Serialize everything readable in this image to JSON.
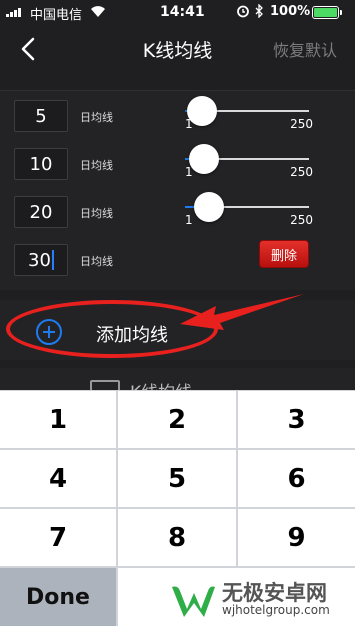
{
  "status_bar": {
    "carrier": "中国电信",
    "time": "14:41",
    "battery_percent": "100%",
    "battery_color": "#4cd964",
    "icons": [
      "signal-icon",
      "wifi-icon",
      "alarm-icon",
      "bluetooth-icon",
      "battery-icon"
    ]
  },
  "navbar": {
    "back_icon": "chevron-left-icon",
    "title": "K线均线",
    "restore_label": "恢复默认"
  },
  "ma_rows": [
    {
      "period": "5",
      "label": "日均线",
      "slider": {
        "min": "1",
        "max": "250",
        "value": 5
      }
    },
    {
      "period": "10",
      "label": "日均线",
      "slider": {
        "min": "1",
        "max": "250",
        "value": 10
      }
    },
    {
      "period": "20",
      "label": "日均线",
      "slider": {
        "min": "1",
        "max": "250",
        "value": 20
      }
    },
    {
      "period": "30",
      "label": "日均线",
      "delete_label": "删除"
    }
  ],
  "add_row": {
    "icon": "plus-circle-icon",
    "label": "添加均线"
  },
  "section_peek": {
    "icon": "kline-icon",
    "label": "K线均线"
  },
  "keypad": {
    "keys": [
      "1",
      "2",
      "3",
      "4",
      "5",
      "6",
      "7",
      "8",
      "9"
    ],
    "done_label": "Done"
  },
  "watermark": {
    "title": "无极安卓网",
    "url": "wjhotelgroup.com"
  },
  "colors": {
    "accent": "#1e7cf0",
    "danger": "#d61f1b",
    "annotation": "#e8201e",
    "background": "#1f1f21"
  }
}
